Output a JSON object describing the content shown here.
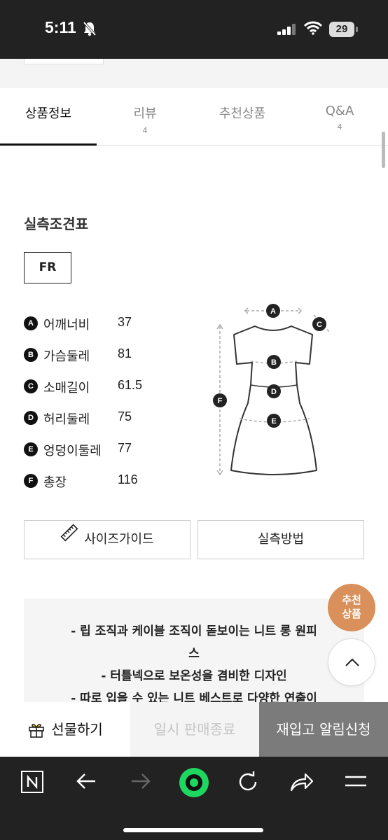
{
  "status_bar": {
    "time": "5:11",
    "battery": "29"
  },
  "tabs": [
    {
      "label": "상품정보",
      "count": ""
    },
    {
      "label": "리뷰",
      "count": "4"
    },
    {
      "label": "추천상품",
      "count": ""
    },
    {
      "label": "Q&A",
      "count": "4"
    }
  ],
  "size_chart": {
    "title": "실측조견표",
    "size_option": "FR",
    "measurements": [
      {
        "key": "A",
        "name": "어깨너비",
        "value": "37"
      },
      {
        "key": "B",
        "name": "가슴둘레",
        "value": "81"
      },
      {
        "key": "C",
        "name": "소매길이",
        "value": "61.5"
      },
      {
        "key": "D",
        "name": "허리둘레",
        "value": "75"
      },
      {
        "key": "E",
        "name": "엉덩이둘레",
        "value": "77"
      },
      {
        "key": "F",
        "name": "총장",
        "value": "116"
      }
    ],
    "diagram_labels": [
      "A",
      "B",
      "C",
      "D",
      "E",
      "F"
    ]
  },
  "buttons": {
    "size_guide": "사이즈가이드",
    "measure_method": "실측방법"
  },
  "description": {
    "lines": [
      "- 립 조직과 케이블 조직이 돋보이는 니트 롱 원피",
      "스",
      "- 터틀넥으로 보온성을 겸비한 디자인",
      "- 따로 입을 수 있는 니트 베스트로 다양한 연출이"
    ]
  },
  "floating": {
    "recommend_line1": "추천",
    "recommend_line2": "상품"
  },
  "bottom_bar": {
    "gift": "선물하기",
    "paused": "일시 판매종료",
    "restock": "재입고 알림신청"
  },
  "colors": {
    "accent_orange": "#d9905a",
    "browser_green": "#1ed760",
    "restock_grey": "#7b7b7b"
  }
}
